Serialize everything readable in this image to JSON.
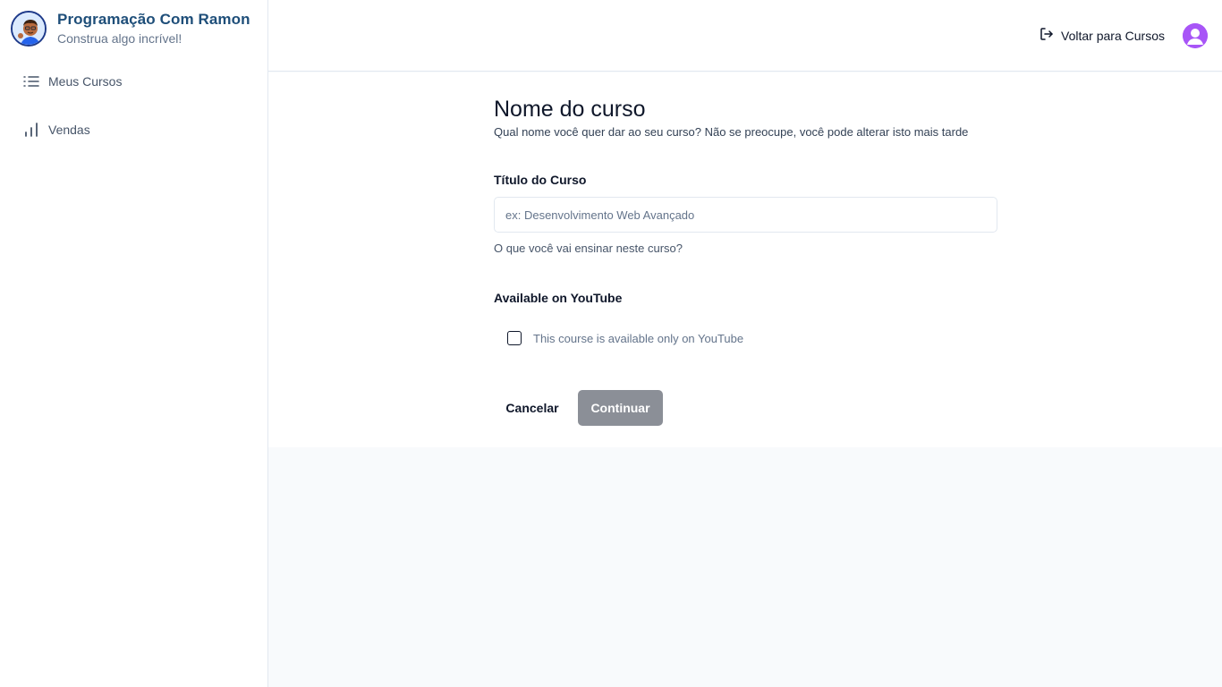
{
  "sidebar": {
    "brand": {
      "title": "Programação Com Ramon",
      "subtitle": "Construa algo incrível!"
    },
    "items": [
      {
        "label": "Meus Cursos",
        "icon": "list-icon"
      },
      {
        "label": "Vendas",
        "icon": "bar-chart-icon"
      }
    ]
  },
  "header": {
    "back_label": "Voltar para Cursos",
    "back_icon": "log-out-icon",
    "user_avatar_color": "#a855f7"
  },
  "main": {
    "title": "Nome do curso",
    "subtitle": "Qual nome você quer dar ao seu curso? Não se preocupe, você pode alterar isto mais tarde",
    "course_title_label": "Título do Curso",
    "course_title_value": "",
    "course_title_placeholder": "ex: Desenvolvimento Web Avançado",
    "course_title_helper": "O que você vai ensinar neste curso?",
    "youtube_label": "Available on YouTube",
    "youtube_checkbox_label": "This course is available only on YouTube",
    "youtube_checked": false,
    "cancel_label": "Cancelar",
    "continue_label": "Continuar"
  },
  "colors": {
    "brand": "#1e4e79",
    "continue_disabled": "#8b8f97",
    "page_bg": "#f8fafc"
  }
}
